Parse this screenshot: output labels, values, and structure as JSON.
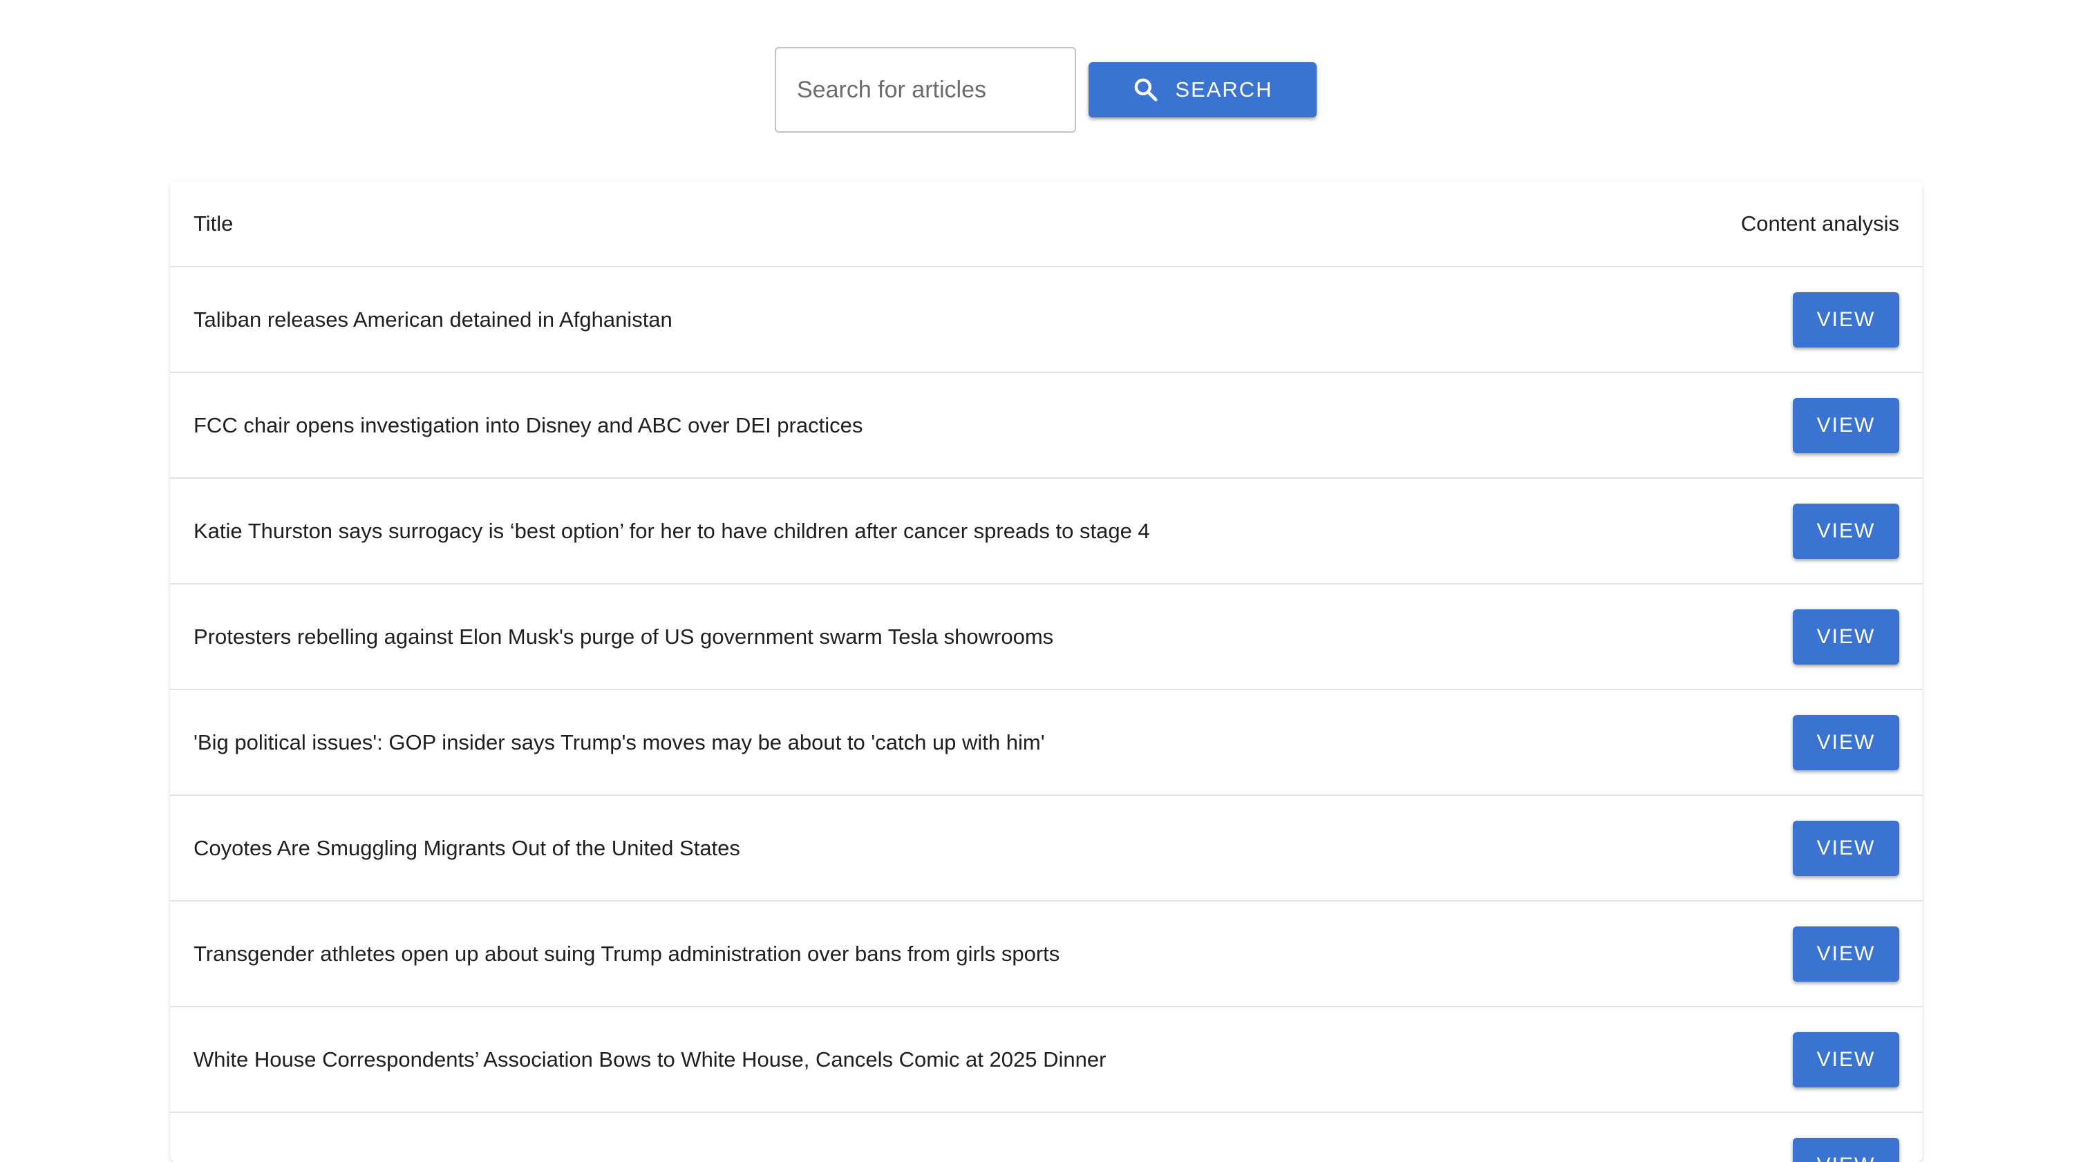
{
  "search": {
    "placeholder": "Search for articles",
    "value": "",
    "button_label": "SEARCH",
    "button_icon": "search-icon"
  },
  "table": {
    "columns": [
      "Title",
      "Content analysis"
    ],
    "rows": [
      {
        "title": "Taliban releases American detained in Afghanistan",
        "action": "VIEW"
      },
      {
        "title": "FCC chair opens investigation into Disney and ABC over DEI practices",
        "action": "VIEW"
      },
      {
        "title": "Katie Thurston says surrogacy is ‘best option’ for her to have children after cancer spreads to stage 4",
        "action": "VIEW"
      },
      {
        "title": "Protesters rebelling against Elon Musk's purge of US government swarm Tesla showrooms",
        "action": "VIEW"
      },
      {
        "title": "'Big political issues': GOP insider says Trump's moves may be about to 'catch up with him'",
        "action": "VIEW"
      },
      {
        "title": "Coyotes Are Smuggling Migrants Out of the United States",
        "action": "VIEW"
      },
      {
        "title": "Transgender athletes open up about suing Trump administration over bans from girls sports",
        "action": "VIEW"
      },
      {
        "title": "White House Correspondents’ Association Bows to White House, Cancels Comic at 2025 Dinner",
        "action": "VIEW"
      },
      {
        "title": "",
        "action": "VIEW"
      }
    ]
  },
  "colors": {
    "accent": "#3a74d0",
    "divider": "#e3e3e3",
    "text": "#1f1f1f"
  }
}
